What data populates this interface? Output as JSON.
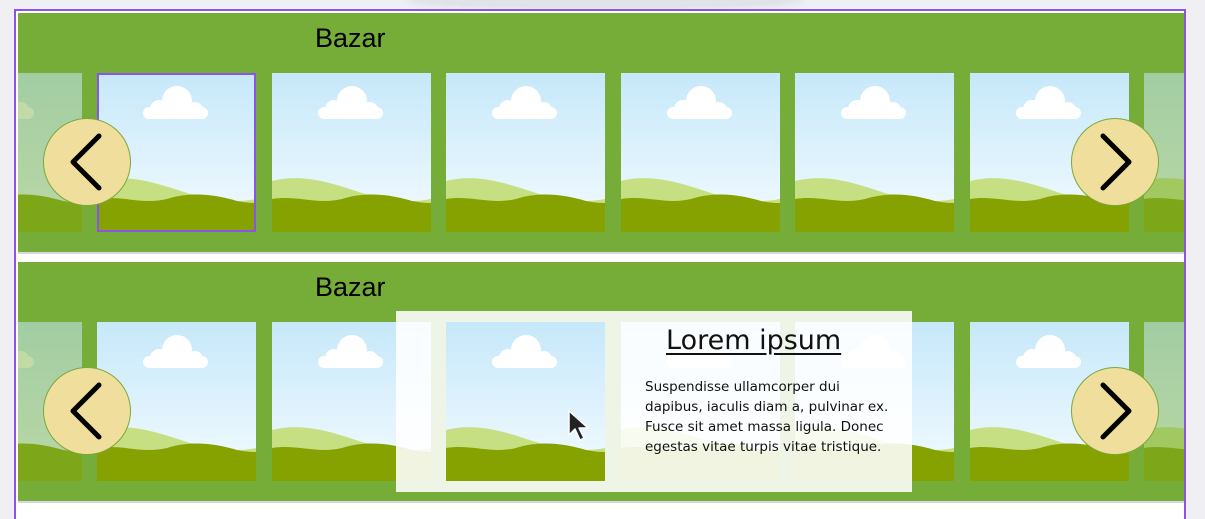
{
  "carousels": [
    {
      "title": "Bazar",
      "prev_icon": "chevron-left-icon",
      "next_icon": "chevron-right-icon"
    },
    {
      "title": "Bazar",
      "prev_icon": "chevron-left-icon",
      "next_icon": "chevron-right-icon",
      "popup": {
        "title": "Lorem ipsum",
        "text": "Suspendisse ullamcorper dui dapibus, iaculis diam a, pulvinar ex. Fusce sit amet massa ligula. Donec egestas vitae turpis vitae tristique."
      }
    }
  ],
  "colors": {
    "band": "#76ad39",
    "nav_fill": "#f0df9c",
    "focus_outline": "#8a55e6",
    "sky_top": "#c6e8fa",
    "sky_bottom": "#f4fbff",
    "hill_light": "#c6df83",
    "hill_dark": "#86a200"
  },
  "cursor_icon": "mouse-pointer-icon"
}
